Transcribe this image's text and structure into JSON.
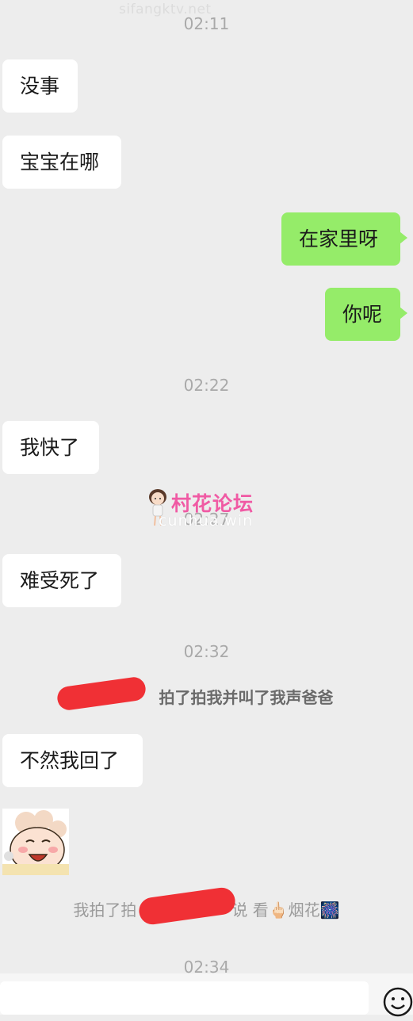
{
  "watermark_top": "sifangktv.net",
  "watermark_logo": {
    "text": "村花论坛",
    "url": "cunhua.win"
  },
  "timestamps": [
    "02:11",
    "02:22",
    "02:27",
    "02:32",
    "02:34"
  ],
  "messages": [
    {
      "side": "left",
      "text": "没事"
    },
    {
      "side": "left",
      "text": "宝宝在哪"
    },
    {
      "side": "right",
      "text": "在家里呀"
    },
    {
      "side": "right",
      "text": "你呢"
    },
    {
      "side": "left",
      "text": "我快了"
    },
    {
      "side": "left",
      "text": "难受死了"
    },
    {
      "side": "left",
      "text": "不然我回了"
    }
  ],
  "system_notices": [
    {
      "text": "拍了拍我并叫了我声爸爸"
    },
    {
      "before": "我拍了拍",
      "after": "说 看",
      "hand": "🖕🏻",
      "tail": "烟花",
      "firework": "🎆"
    }
  ],
  "sticker": {
    "name": "laughing-cartoon-sticker"
  },
  "input": {
    "placeholder": ""
  },
  "colors": {
    "background": "#ededed",
    "bubble_right": "#95ec69",
    "bubble_left": "#ffffff",
    "redaction": "#f0262b"
  }
}
